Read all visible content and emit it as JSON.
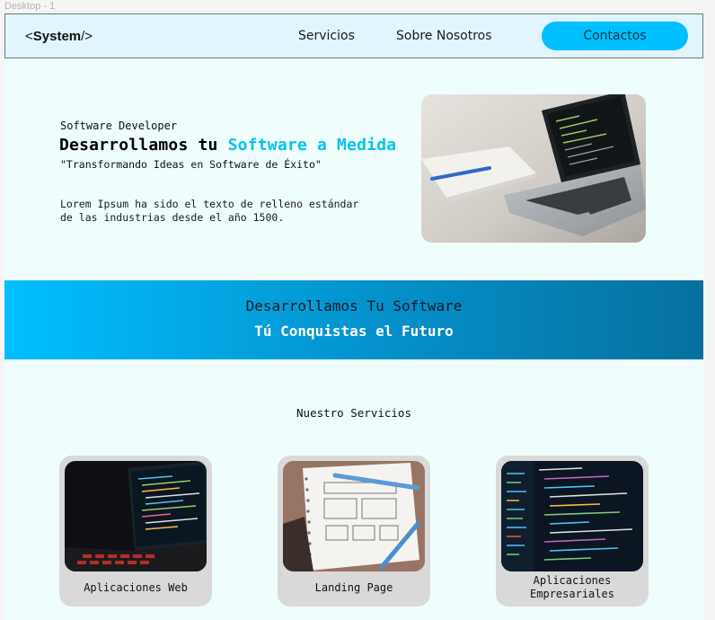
{
  "frame": {
    "label": "Desktop - 1"
  },
  "header": {
    "logo_prefix": "<",
    "logo_name": "System",
    "logo_suffix": "/>",
    "nav": [
      "Servicios",
      "Sobre Nosotros"
    ],
    "contact_label": "Contactos"
  },
  "hero": {
    "subtitle": "Software Developer",
    "title_plain": "Desarrollamos tu ",
    "title_accent": "Software a Medida",
    "quote": "\"Transformando Ideas en Software de Éxito\"",
    "description": "Lorem Ipsum ha sido el texto de relleno estándar de las industrias desde el año 1500.",
    "image_icon": "laptop-desk-photo"
  },
  "banner": {
    "line1": "Desarrollamos Tu Software",
    "line2": "Tú Conquistas el Futuro"
  },
  "services": {
    "title": "Nuestro Servicios",
    "cards": [
      {
        "label": "Aplicaciones Web",
        "image_icon": "laptop-code-photo"
      },
      {
        "label": "Landing Page",
        "image_icon": "sketch-notebook-photo"
      },
      {
        "label": "Aplicaciones Empresariales",
        "image_icon": "code-screen-photo"
      }
    ]
  },
  "colors": {
    "accent": "#00c3ef",
    "button": "#00bfff",
    "banner_start": "#00bfff",
    "banner_end": "#06709e",
    "page_bg": "#effdfc",
    "header_bg": "#e1f5fe"
  }
}
